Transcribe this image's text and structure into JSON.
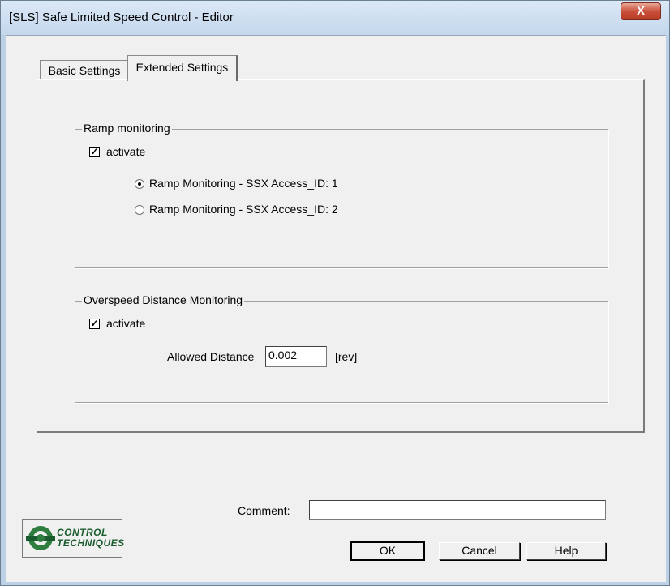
{
  "window": {
    "title": "[SLS] Safe Limited Speed Control - Editor",
    "close_label": "X"
  },
  "tabs": [
    {
      "label": "Basic Settings",
      "active": false
    },
    {
      "label": "Extended Settings",
      "active": true
    }
  ],
  "ramp_monitoring": {
    "legend": "Ramp monitoring",
    "activate_label": "activate",
    "activate_checked": true,
    "options": [
      {
        "label": "Ramp Monitoring - SSX Access_ID: 1",
        "selected": true
      },
      {
        "label": "Ramp Monitoring - SSX Access_ID: 2",
        "selected": false
      }
    ]
  },
  "overspeed_distance": {
    "legend": "Overspeed Distance Monitoring",
    "activate_label": "activate",
    "activate_checked": true,
    "allowed_distance_label": "Allowed Distance",
    "allowed_distance_value": "0.002",
    "unit": "[rev]"
  },
  "comment": {
    "label": "Comment:",
    "value": ""
  },
  "logo": {
    "line1": "CONTROL",
    "line2": "TECHNIQUES"
  },
  "buttons": {
    "ok": "OK",
    "cancel": "Cancel",
    "help": "Help"
  },
  "colors": {
    "titlebar": "#c4d7ec",
    "close": "#c9503b",
    "client_bg": "#f0f0f0",
    "logo_green": "#1a5c2e"
  }
}
